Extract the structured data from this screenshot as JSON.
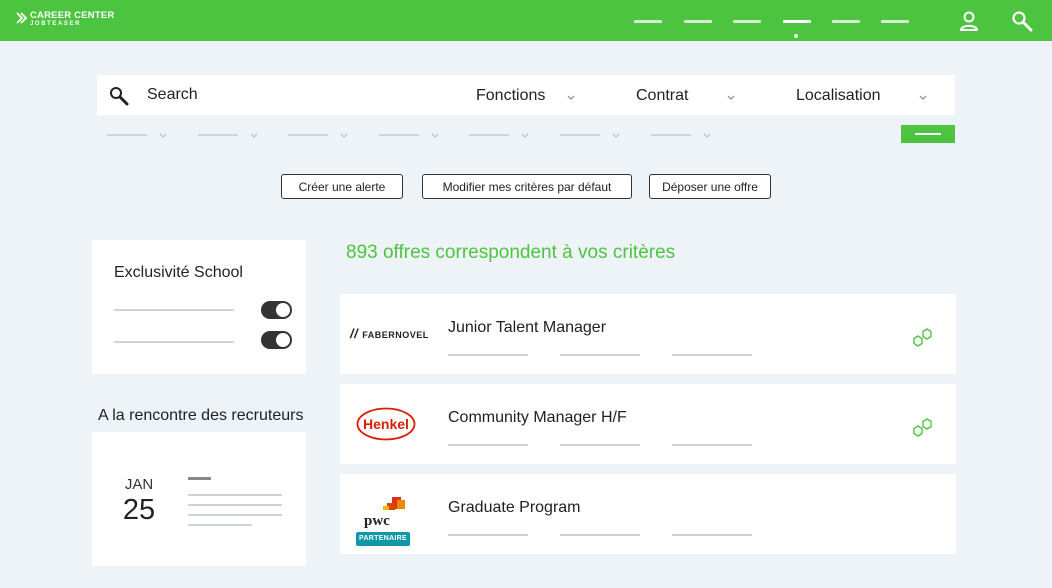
{
  "header": {
    "logo_line1": "CAREER CENTER",
    "logo_line2": "JOBTEASER",
    "brand_color": "#4cc440",
    "nav_items": 6,
    "active_nav_index": 3,
    "icons": [
      "user-icon",
      "search-icon"
    ]
  },
  "search": {
    "placeholder": "Search",
    "filters": [
      {
        "label": "Fonctions"
      },
      {
        "label": "Contrat"
      },
      {
        "label": "Localisation"
      }
    ]
  },
  "actions": {
    "create_alert": "Créer une alerte",
    "edit_criteria": "Modifier mes critères par défaut",
    "post_offer": "Déposer une offre"
  },
  "sidebar": {
    "exclusivity_title": "Exclusivité School",
    "recruiters_title": "A la rencontre des recruteurs",
    "event": {
      "month": "JAN",
      "day": "25"
    }
  },
  "results": {
    "count_text": "893 offres correspondent à vos critères",
    "jobs": [
      {
        "company": "FABERNOVEL",
        "title": "Junior Talent Manager"
      },
      {
        "company": "Henkel",
        "title": "Community Manager H/F"
      },
      {
        "company": "pwc",
        "title": "Graduate Program",
        "badge": "PARTENAIRE"
      }
    ]
  }
}
